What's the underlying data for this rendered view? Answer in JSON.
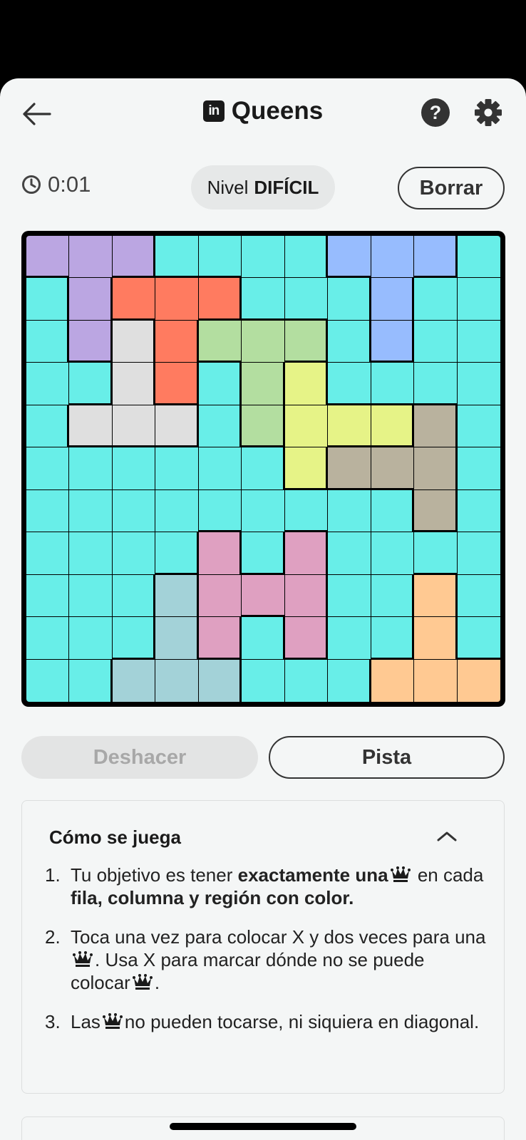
{
  "header": {
    "logo_text": "in",
    "title": "Queens"
  },
  "icons": {
    "back": "arrow-left-icon",
    "help": "question-circle-icon",
    "settings": "gear-icon",
    "timer": "clock-icon",
    "chevron": "chevron-up-icon",
    "queen": "crown-icon"
  },
  "status": {
    "time": "0:01",
    "level_prefix": "Nivel",
    "level_value": "DIFÍCIL",
    "clear_label": "Borrar"
  },
  "colors": {
    "C": "#68eee8",
    "P": "#bba6e2",
    "B": "#97bcfe",
    "O": "#ff7b60",
    "W": "#dfdfdf",
    "G": "#b3dea0",
    "Y": "#e6f387",
    "T": "#b9b29e",
    "K": "#dfa0c1",
    "L": "#a3d2d8",
    "N": "#ffc992"
  },
  "board": {
    "size": 11,
    "rows": [
      "PPPCCCCBBBC",
      "CPOOOCCCBCC",
      "CPWOGGGCBCC",
      "CCWOCGYCCCC",
      "CWWWCGYYYTC",
      "CCCCCCYTTTC",
      "CCCCCCCCCTC",
      "CCCCKCKCCCC",
      "CCCLKKKCCNC",
      "CCCLKCKCCNC",
      "CCLLLCCCNNN"
    ]
  },
  "actions": {
    "undo_label": "Deshacer",
    "hint_label": "Pista"
  },
  "howto": {
    "title": "Cómo se juega",
    "steps": [
      {
        "num": "1.",
        "t1": "Tu objetivo es tener ",
        "b1": "exactamente una",
        "t2": " en cada ",
        "b2": "fila, columna y región con color."
      },
      {
        "num": "2.",
        "t1": "Toca una vez para colocar X y dos veces para una",
        "t2": ". Usa X para marcar dónde no se puede colocar",
        "t3": "."
      },
      {
        "num": "3.",
        "t1": "Las",
        "t2": "no pueden tocarse, ni siquiera en diagonal."
      }
    ]
  }
}
